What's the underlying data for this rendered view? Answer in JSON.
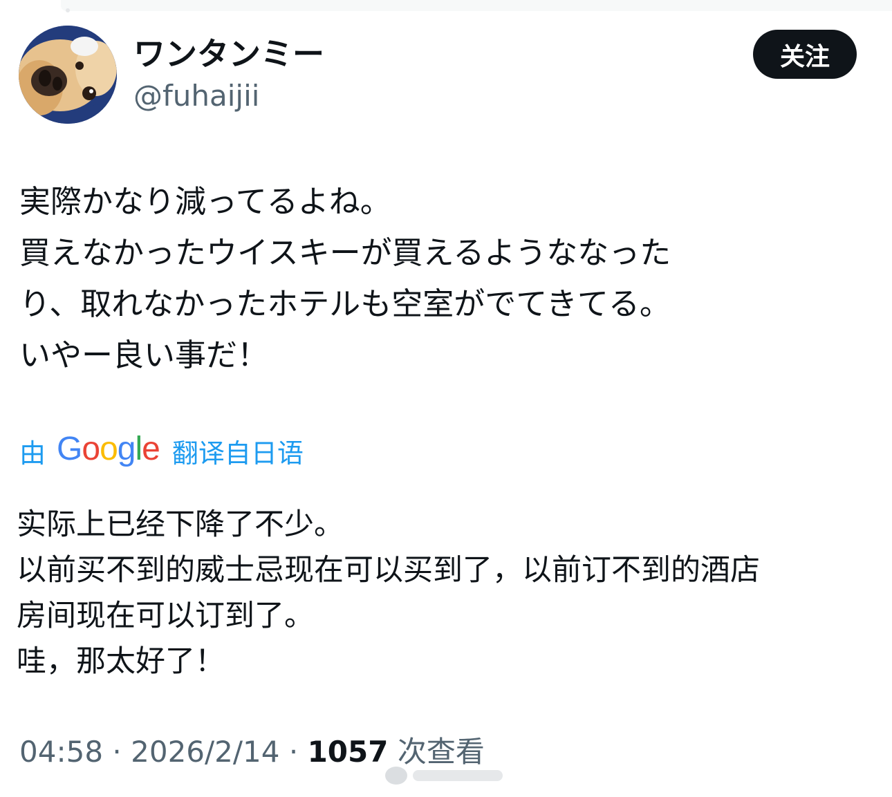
{
  "author": {
    "display_name": "ワンタンミー",
    "handle": "@fuhaijii",
    "avatar_icon": "dog-avatar-icon"
  },
  "follow_button": {
    "label": "关注"
  },
  "tweet": {
    "lines": [
      "実際かなり減ってるよね。",
      "買えなかったウイスキーが買えるようななった",
      "り、取れなかったホテルも空室がでてきてる。",
      "いやー良い事だ！"
    ]
  },
  "translation": {
    "by_label": "由",
    "provider": "Google",
    "source_label": "翻译自日语",
    "lines": [
      "实际上已经下降了不少。",
      "以前买不到的威士忌现在可以买到了，以前订不到的酒店",
      "房间现在可以订到了。",
      "哇，那太好了！"
    ]
  },
  "meta": {
    "time": "04:58",
    "separator": "·",
    "date": "2026/2/14",
    "views_count": "1057",
    "views_label": "次查看"
  },
  "colors": {
    "link_blue": "#1d9bf0",
    "text_primary": "#0f1419",
    "text_secondary": "#536471",
    "button_bg": "#0f1419"
  }
}
